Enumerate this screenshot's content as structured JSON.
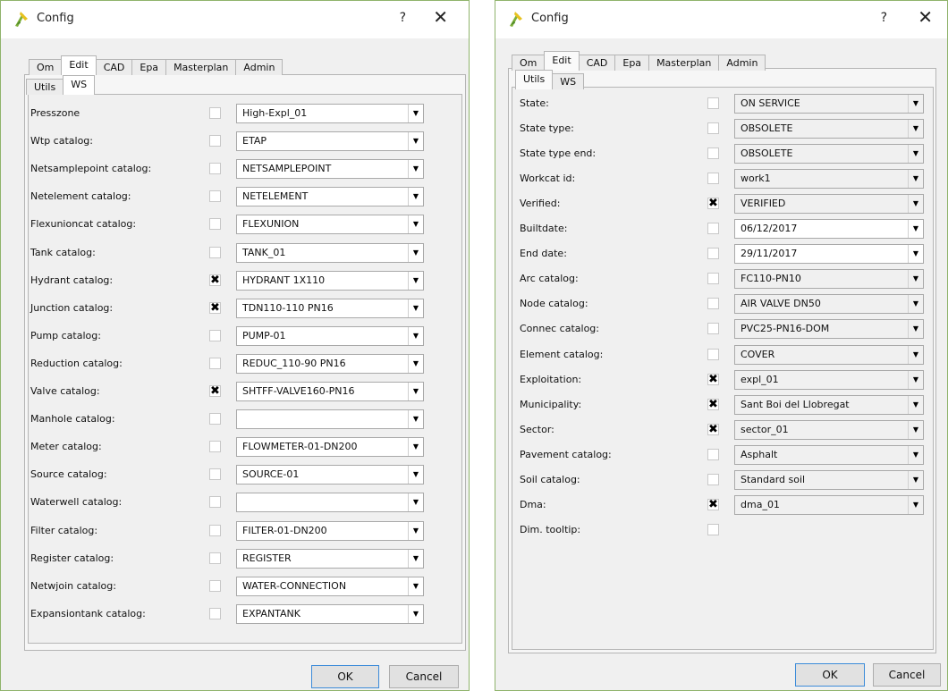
{
  "colors": {
    "dialog_bg": "#f0f0f0",
    "frame_border": "#8fb36b",
    "default_button_border": "#3c8bd9"
  },
  "left_dialog": {
    "title": "Config",
    "help": "?",
    "close": "✕",
    "tabs": [
      "Om",
      "Edit",
      "CAD",
      "Epa",
      "Masterplan",
      "Admin"
    ],
    "active_tab": "Edit",
    "subtabs": [
      "Utils",
      "WS"
    ],
    "active_subtab": "WS",
    "rows": [
      {
        "label": "Presszone",
        "checked": false,
        "value": "High-Expl_01"
      },
      {
        "label": "Wtp catalog:",
        "checked": false,
        "value": "ETAP"
      },
      {
        "label": "Netsamplepoint catalog:",
        "checked": false,
        "value": "NETSAMPLEPOINT"
      },
      {
        "label": "Netelement catalog:",
        "checked": false,
        "value": "NETELEMENT"
      },
      {
        "label": "Flexunioncat catalog:",
        "checked": false,
        "value": "FLEXUNION"
      },
      {
        "label": "Tank catalog:",
        "checked": false,
        "value": "TANK_01"
      },
      {
        "label": "Hydrant catalog:",
        "checked": true,
        "value": "HYDRANT 1X110"
      },
      {
        "label": "Junction catalog:",
        "checked": true,
        "value": "TDN110-110 PN16"
      },
      {
        "label": "Pump catalog:",
        "checked": false,
        "value": "PUMP-01"
      },
      {
        "label": "Reduction catalog:",
        "checked": false,
        "value": "REDUC_110-90 PN16"
      },
      {
        "label": "Valve catalog:",
        "checked": true,
        "value": "SHTFF-VALVE160-PN16"
      },
      {
        "label": "Manhole catalog:",
        "checked": false,
        "value": ""
      },
      {
        "label": "Meter catalog:",
        "checked": false,
        "value": "FLOWMETER-01-DN200"
      },
      {
        "label": "Source catalog:",
        "checked": false,
        "value": "SOURCE-01"
      },
      {
        "label": "Waterwell catalog:",
        "checked": false,
        "value": ""
      },
      {
        "label": "Filter catalog:",
        "checked": false,
        "value": "FILTER-01-DN200"
      },
      {
        "label": "Register catalog:",
        "checked": false,
        "value": "REGISTER"
      },
      {
        "label": "Netwjoin catalog:",
        "checked": false,
        "value": "WATER-CONNECTION"
      },
      {
        "label": "Expansiontank catalog:",
        "checked": false,
        "value": "EXPANTANK"
      }
    ],
    "ok_label": "OK",
    "cancel_label": "Cancel"
  },
  "right_dialog": {
    "title": "Config",
    "help": "?",
    "close": "✕",
    "tabs": [
      "Om",
      "Edit",
      "CAD",
      "Epa",
      "Masterplan",
      "Admin"
    ],
    "active_tab": "Edit",
    "subtabs": [
      "Utils",
      "WS"
    ],
    "active_subtab": "Utils",
    "rows": [
      {
        "label": "State:",
        "checked": false,
        "value": "ON SERVICE",
        "editable": false
      },
      {
        "label": "State type:",
        "checked": false,
        "value": "OBSOLETE",
        "editable": false
      },
      {
        "label": "State type end:",
        "checked": false,
        "value": "OBSOLETE",
        "editable": false
      },
      {
        "label": "Workcat id:",
        "checked": false,
        "value": "work1",
        "editable": false
      },
      {
        "label": "Verified:",
        "checked": true,
        "value": "VERIFIED",
        "editable": false
      },
      {
        "label": "Builtdate:",
        "checked": false,
        "value": "06/12/2017",
        "editable": true
      },
      {
        "label": "End date:",
        "checked": false,
        "value": "29/11/2017",
        "editable": true
      },
      {
        "label": "Arc catalog:",
        "checked": false,
        "value": "FC110-PN10",
        "editable": false
      },
      {
        "label": "Node catalog:",
        "checked": false,
        "value": "AIR VALVE DN50",
        "editable": false
      },
      {
        "label": "Connec catalog:",
        "checked": false,
        "value": "PVC25-PN16-DOM",
        "editable": false
      },
      {
        "label": "Element catalog:",
        "checked": false,
        "value": "COVER",
        "editable": false
      },
      {
        "label": "Exploitation:",
        "checked": true,
        "value": "expl_01",
        "editable": false
      },
      {
        "label": "Municipality:",
        "checked": true,
        "value": "Sant Boi del Llobregat",
        "editable": false
      },
      {
        "label": "Sector:",
        "checked": true,
        "value": "sector_01",
        "editable": false
      },
      {
        "label": "Pavement catalog:",
        "checked": false,
        "value": "Asphalt",
        "editable": false
      },
      {
        "label": "Soil catalog:",
        "checked": false,
        "value": "Standard soil",
        "editable": false
      },
      {
        "label": "Dma:",
        "checked": true,
        "value": "dma_01",
        "editable": false
      },
      {
        "label": "Dim. tooltip:",
        "checked": false,
        "value": null,
        "editable": false
      }
    ],
    "ok_label": "OK",
    "cancel_label": "Cancel"
  }
}
